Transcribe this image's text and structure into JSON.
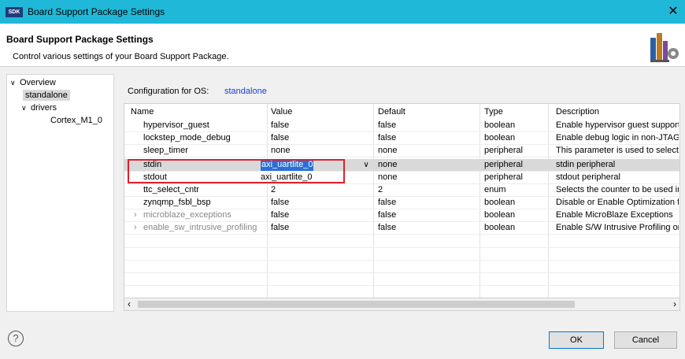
{
  "window": {
    "title": "Board Support Package Settings",
    "icon_text": "SDK",
    "close_glyph": "✕"
  },
  "header": {
    "title": "Board Support Package Settings",
    "description": "Control various settings of your Board Support Package."
  },
  "nav": {
    "items": [
      {
        "label": "Overview",
        "expanded": true
      },
      {
        "label": "standalone",
        "selected": true
      },
      {
        "label": "drivers",
        "expanded": true
      },
      {
        "label": "Cortex_M1_0"
      }
    ]
  },
  "config": {
    "label": "Configuration for OS:",
    "os": "standalone"
  },
  "table": {
    "columns": [
      "Name",
      "Value",
      "Default",
      "Type",
      "Description"
    ],
    "rows": [
      {
        "name": "hypervisor_guest",
        "value": "false",
        "default": "false",
        "type": "boolean",
        "description": "Enable hypervisor guest support"
      },
      {
        "name": "lockstep_mode_debug",
        "value": "false",
        "default": "false",
        "type": "boolean",
        "description": "Enable debug logic in non-JTAG"
      },
      {
        "name": "sleep_timer",
        "value": "none",
        "default": "none",
        "type": "peripheral",
        "description": "This parameter is used to select s"
      },
      {
        "name": "stdin",
        "value": "axi_uartlite_0",
        "default": "none",
        "type": "peripheral",
        "description": "stdin peripheral",
        "selected": true
      },
      {
        "name": "stdout",
        "value": "axi_uartlite_0",
        "default": "none",
        "type": "peripheral",
        "description": "stdout peripheral"
      },
      {
        "name": "ttc_select_cntr",
        "value": "2",
        "default": "2",
        "type": "enum",
        "description": "Selects the counter to be used in"
      },
      {
        "name": "zynqmp_fsbl_bsp",
        "value": "false",
        "default": "false",
        "type": "boolean",
        "description": "Disable or Enable Optimization f"
      },
      {
        "name": "microblaze_exceptions",
        "value": "false",
        "default": "false",
        "type": "boolean",
        "description": "Enable MicroBlaze Exceptions",
        "expandable": true
      },
      {
        "name": "enable_sw_intrusive_profiling",
        "value": "false",
        "default": "false",
        "type": "boolean",
        "description": "Enable S/W Intrusive Profiling or",
        "expandable": true
      }
    ],
    "dropdown_glyph": "∨",
    "expand_glyph": "›"
  },
  "scroll": {
    "left": "‹",
    "right": "›"
  },
  "footer": {
    "help_glyph": "?",
    "ok_label": "OK",
    "cancel_label": "Cancel"
  },
  "colors": {
    "titlebar": "#1fb8d8",
    "link_blue": "#1a3fd6",
    "highlight_red": "#e0202a",
    "selection_blue": "#2a6fd6"
  }
}
